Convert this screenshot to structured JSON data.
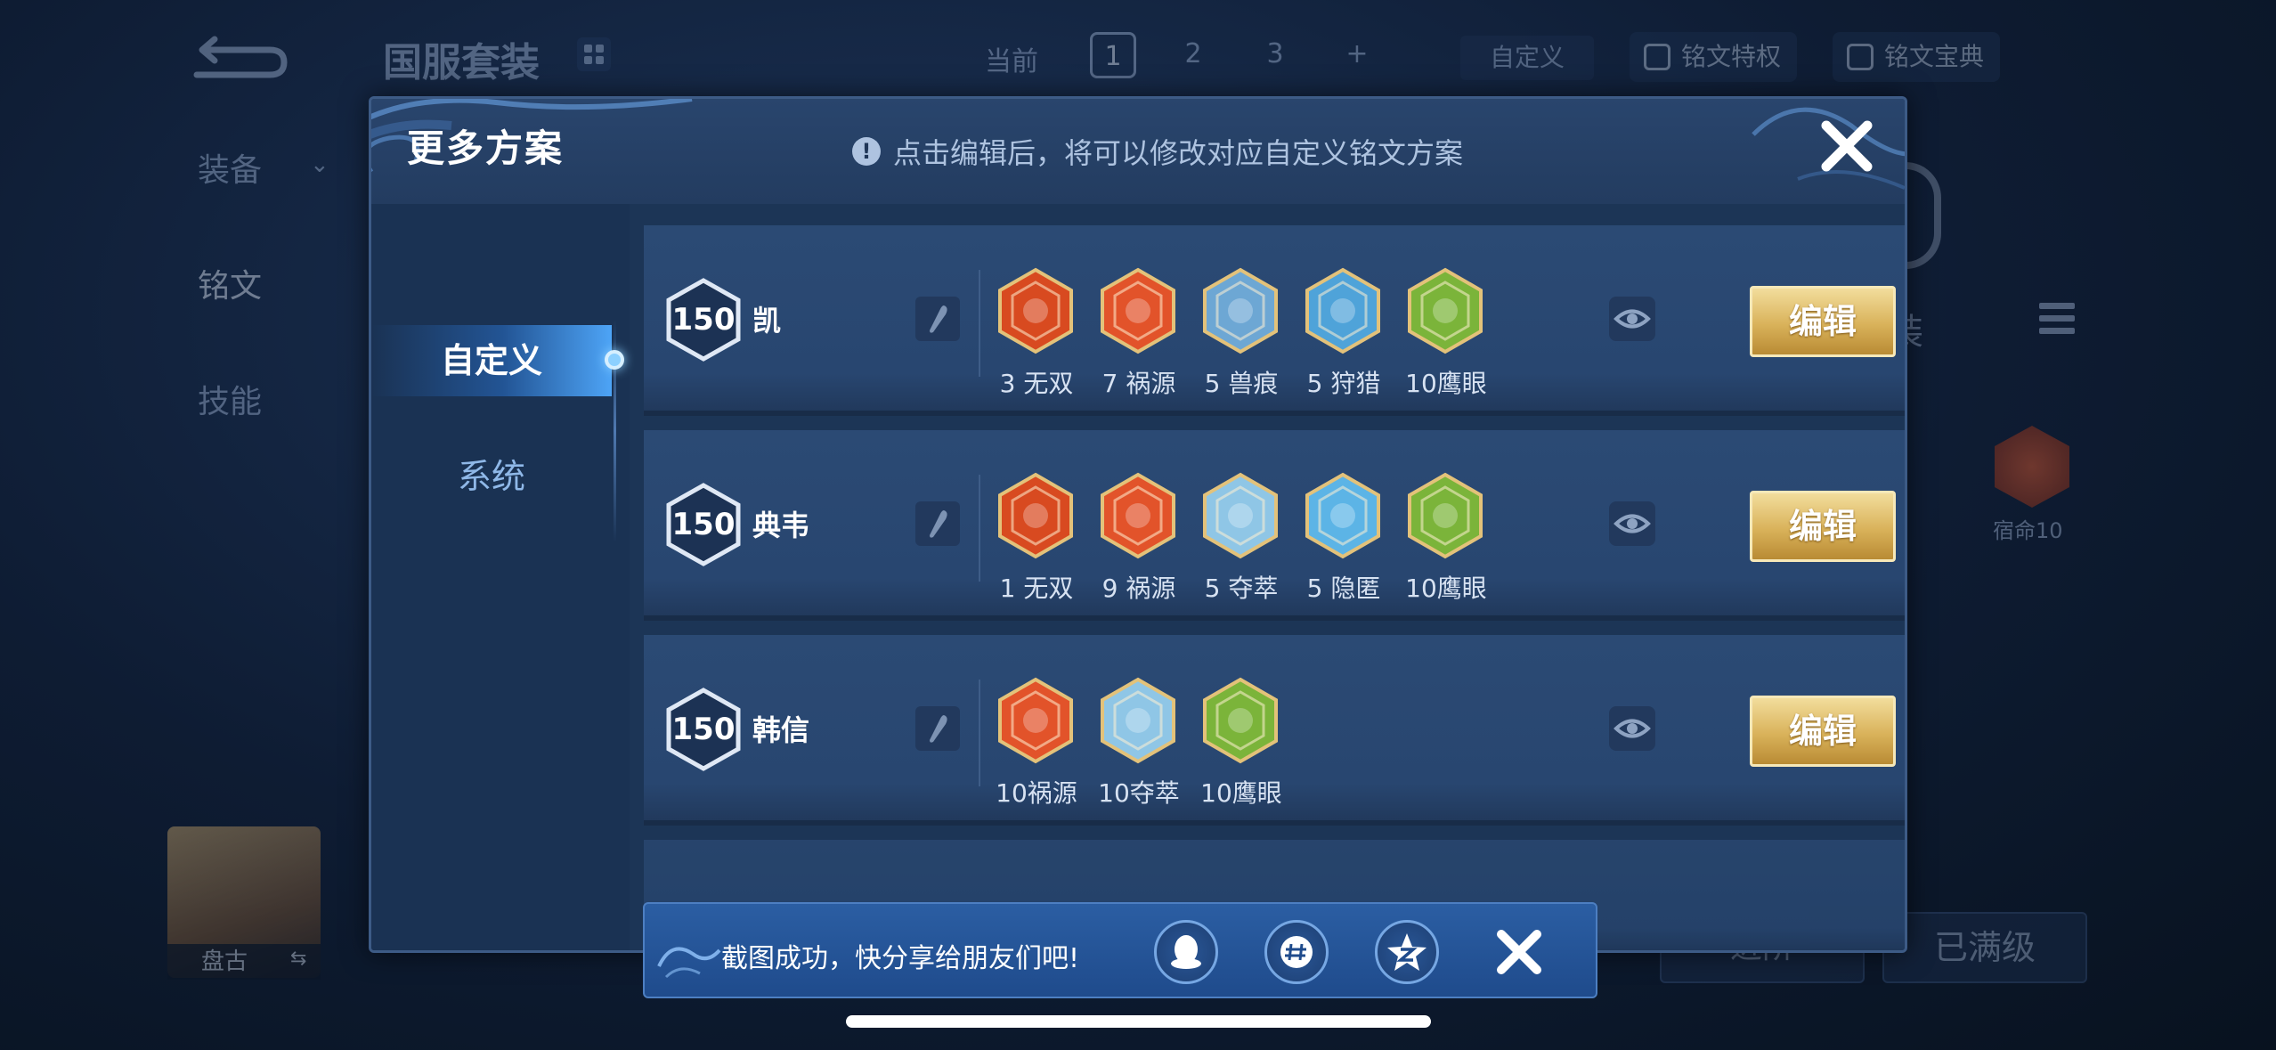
{
  "background": {
    "title": "国服套装",
    "current_label": "当前",
    "pages": [
      "1",
      "2",
      "3",
      "+"
    ],
    "custom_label": "自定义",
    "privilege_label": "铭文特权",
    "codex_label": "铭文宝典",
    "nav": [
      "装备",
      "铭文",
      "技能"
    ],
    "hero_name": "盘古",
    "zhuang_label": "装",
    "rune_label": "宿命10",
    "upgrade_label": "进阶",
    "maxed_label": "已满级"
  },
  "modal": {
    "title": "更多方案",
    "notice": "点击编辑后，将可以修改对应自定义铭文方案",
    "tabs": {
      "custom": "自定义",
      "system": "系统"
    },
    "edit_label": "编辑",
    "rows": [
      {
        "level": "150",
        "hero": "凯",
        "runes": [
          {
            "label": "3 无双",
            "color": "#d84a20",
            "icon": "red-rune-wushuang"
          },
          {
            "label": "7 祸源",
            "color": "#e2532a",
            "icon": "red-rune-huoyuan"
          },
          {
            "label": "5 兽痕",
            "color": "#6da7d4",
            "icon": "blue-rune-shouhen"
          },
          {
            "label": "5 狩猎",
            "color": "#4fa3d9",
            "icon": "blue-rune-shoulie"
          },
          {
            "label": "10鹰眼",
            "color": "#7bb43a",
            "icon": "green-rune-yingyan"
          }
        ]
      },
      {
        "level": "150",
        "hero": "典韦",
        "runes": [
          {
            "label": "1 无双",
            "color": "#d84a20",
            "icon": "red-rune-wushuang"
          },
          {
            "label": "9 祸源",
            "color": "#e2532a",
            "icon": "red-rune-huoyuan"
          },
          {
            "label": "5 夺萃",
            "color": "#8fc6e6",
            "icon": "blue-rune-duocui"
          },
          {
            "label": "5 隐匿",
            "color": "#5cb4e6",
            "icon": "blue-rune-yinni"
          },
          {
            "label": "10鹰眼",
            "color": "#7bb43a",
            "icon": "green-rune-yingyan"
          }
        ]
      },
      {
        "level": "150",
        "hero": "韩信",
        "runes": [
          {
            "label": "10祸源",
            "color": "#e2532a",
            "icon": "red-rune-huoyuan"
          },
          {
            "label": "10夺萃",
            "color": "#8fc6e6",
            "icon": "blue-rune-duocui"
          },
          {
            "label": "10鹰眼",
            "color": "#7bb43a",
            "icon": "green-rune-yingyan"
          }
        ]
      }
    ]
  },
  "toast": {
    "text": "截图成功，快分享给朋友们吧!"
  },
  "colors": {
    "accent_gold": "#d9b25a",
    "modal_bg": "#1c3556",
    "toast_bg": "#2b5ea3"
  }
}
